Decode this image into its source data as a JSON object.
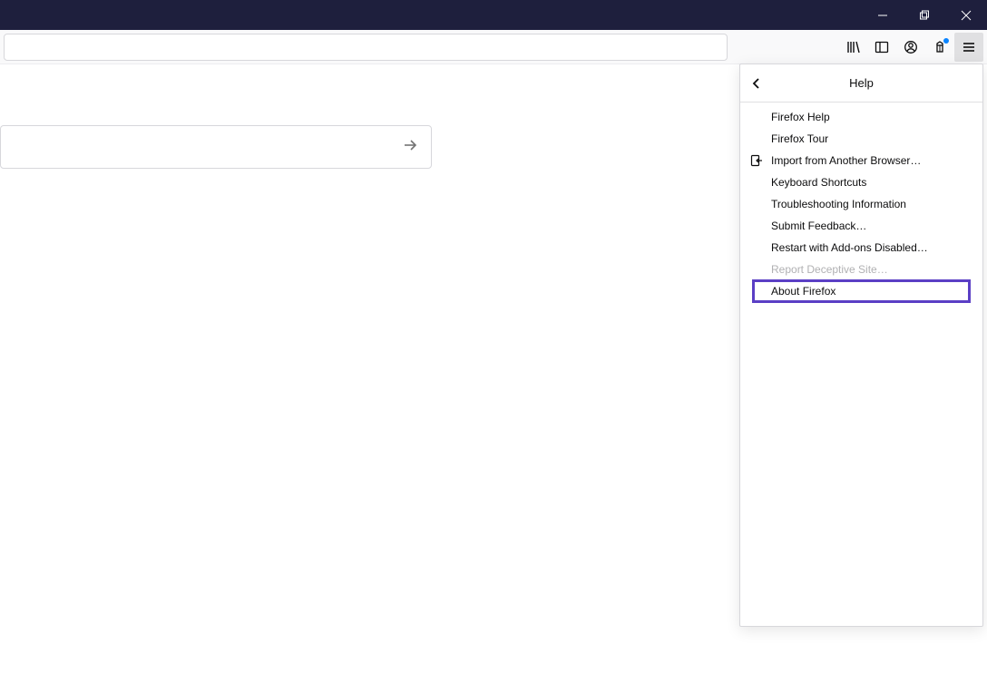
{
  "panel": {
    "title": "Help",
    "items": [
      {
        "label": "Firefox Help",
        "icon": "",
        "disabled": false,
        "highlighted": false
      },
      {
        "label": "Firefox Tour",
        "icon": "",
        "disabled": false,
        "highlighted": false
      },
      {
        "label": "Import from Another Browser…",
        "icon": "import",
        "disabled": false,
        "highlighted": false
      },
      {
        "label": "Keyboard Shortcuts",
        "icon": "",
        "disabled": false,
        "highlighted": false
      },
      {
        "label": "Troubleshooting Information",
        "icon": "",
        "disabled": false,
        "highlighted": false
      },
      {
        "label": "Submit Feedback…",
        "icon": "",
        "disabled": false,
        "highlighted": false
      },
      {
        "label": "Restart with Add-ons Disabled…",
        "icon": "",
        "disabled": false,
        "highlighted": false
      },
      {
        "label": "Report Deceptive Site…",
        "icon": "",
        "disabled": true,
        "highlighted": false
      },
      {
        "label": "About Firefox",
        "icon": "",
        "disabled": false,
        "highlighted": true
      }
    ]
  }
}
